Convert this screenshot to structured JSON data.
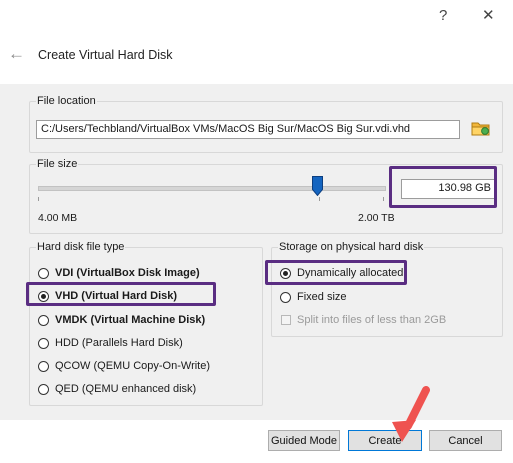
{
  "window": {
    "help_glyph": "?",
    "close_glyph": "✕"
  },
  "header": {
    "back_glyph": "←",
    "title": "Create Virtual Hard Disk"
  },
  "file_location": {
    "label": "File location",
    "path": "C:/Users/Techbland/VirtualBox VMs/MacOS Big Sur/MacOS Big Sur.vdi.vhd"
  },
  "file_size": {
    "label": "File size",
    "value": "130.98 GB",
    "min_label": "4.00 MB",
    "max_label": "2.00 TB"
  },
  "disk_type": {
    "label": "Hard disk file type",
    "options": [
      {
        "label": "VDI (VirtualBox Disk Image)",
        "selected": false
      },
      {
        "label": "VHD (Virtual Hard Disk)",
        "selected": true
      },
      {
        "label": "VMDK (Virtual Machine Disk)",
        "selected": false
      },
      {
        "label": "HDD (Parallels Hard Disk)",
        "selected": false
      },
      {
        "label": "QCOW (QEMU Copy-On-Write)",
        "selected": false
      },
      {
        "label": "QED (QEMU enhanced disk)",
        "selected": false
      }
    ]
  },
  "storage": {
    "label": "Storage on physical hard disk",
    "options": [
      {
        "label": "Dynamically allocated",
        "selected": true
      },
      {
        "label": "Fixed size",
        "selected": false
      }
    ],
    "split_label": "Split into files of less than 2GB"
  },
  "buttons": {
    "guided_mode": "Guided Mode",
    "create": "Create",
    "cancel": "Cancel"
  },
  "colors": {
    "highlight": "#5a2d82",
    "arrow": "#ef5350",
    "thumb": "#1565c0"
  }
}
